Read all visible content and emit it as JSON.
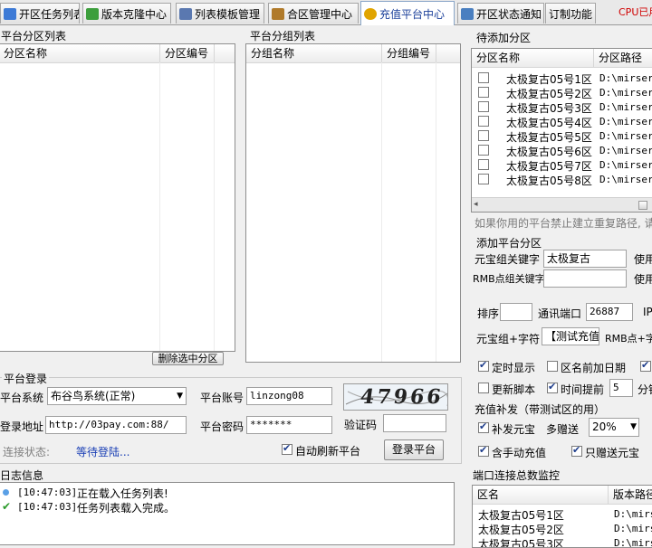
{
  "tabs": [
    {
      "label": "开区任务列表",
      "icon": "calendar-icon",
      "color": "#3d7ad6"
    },
    {
      "label": "版本克隆中心",
      "icon": "clone-icon",
      "color": "#3c9e3c"
    },
    {
      "label": "列表模板管理",
      "icon": "template-icon",
      "color": "#5a78b0"
    },
    {
      "label": "合区管理中心",
      "icon": "merge-icon",
      "color": "#b07a2a"
    },
    {
      "label": "充值平台中心",
      "icon": "coin-icon",
      "color": "#e0a400"
    },
    {
      "label": "开区状态通知",
      "icon": "notify-icon",
      "color": "#4a7fc0"
    },
    {
      "label": "订制功能",
      "icon": "custom-icon",
      "color": "#888888"
    }
  ],
  "cpu_text": "CPU已用",
  "platform_partition_list": {
    "title": "平台分区列表",
    "columns": [
      "分区名称",
      "分区编号"
    ],
    "delete_button": "删除选中分区"
  },
  "platform_group_list": {
    "title": "平台分组列表",
    "columns": [
      "分组名称",
      "分组编号"
    ]
  },
  "pending_partitions": {
    "title": "待添加分区",
    "columns": [
      "分区名称",
      "分区路径"
    ],
    "rows": [
      {
        "name": "太极复古05号1区",
        "path": "D:\\mirserv",
        "checked": false
      },
      {
        "name": "太极复古05号2区",
        "path": "D:\\mirserv",
        "checked": false
      },
      {
        "name": "太极复古05号3区",
        "path": "D:\\mirserv",
        "checked": false
      },
      {
        "name": "太极复古05号4区",
        "path": "D:\\mirserv",
        "checked": false
      },
      {
        "name": "太极复古05号5区",
        "path": "D:\\mirserv",
        "checked": false
      },
      {
        "name": "太极复古05号6区",
        "path": "D:\\mirserv",
        "checked": false
      },
      {
        "name": "太极复古05号7区",
        "path": "D:\\mirserv",
        "checked": false
      },
      {
        "name": "太极复古05号8区",
        "path": "D:\\mirserv",
        "checked": false
      }
    ],
    "hint": "如果你用的平台禁止建立重复路径, 请"
  },
  "add_partition": {
    "title": "添加平台分区",
    "yuanbao_keyword_label": "元宝组关键字",
    "yuanbao_keyword_value": "太极复古",
    "use_label_1": "使用",
    "rmb_keyword_label": "RMB点组关键字",
    "rmb_keyword_value": "",
    "use_label_2": "使用",
    "sort_label": "排序",
    "sort_value": "",
    "port_label": "通讯端口",
    "port_value": "26887",
    "ip_label": "IP",
    "yuanbao_group_label": "元宝组+字符",
    "yuanbao_group_value": "【测试充值",
    "rmb_group_label": "RMB点+字符",
    "opt_timed_show": "定时显示",
    "opt_date_prefix": "区名前加日期",
    "opt_update_script": "更新脚本",
    "opt_time_advance": "时间提前",
    "time_advance_value": "5",
    "minute_label": "分钟"
  },
  "topup_bonus": {
    "title": "充值补发（带测试区的用）",
    "opt_bonus_yuanbao": "补发元宝",
    "more_gift_label": "多赠送",
    "more_gift_value": "20%",
    "opt_manual_topup": "含手动充值",
    "opt_gift_only_yuanbao": "只赠送元宝"
  },
  "platform_login": {
    "title": "平台登录",
    "system_label": "平台系统",
    "system_value": "布谷鸟系统(正常)",
    "account_label": "平台账号",
    "account_value": "linzong08",
    "captcha_text": "47966",
    "url_label": "登录地址",
    "url_value": "http://03pay.com:88/",
    "password_label": "平台密码",
    "password_value": "*******",
    "code_label": "验证码",
    "code_value": "",
    "status_label": "连接状态:",
    "status_value": "等待登陆...",
    "auto_refresh_label": "自动刷新平台",
    "login_button": "登录平台"
  },
  "log": {
    "title": "日志信息",
    "lines": [
      {
        "time": "[10:47:03]",
        "text": "正在载入任务列表!",
        "icon": "info-dot-icon"
      },
      {
        "time": "[10:47:03]",
        "text": "任务列表载入完成。",
        "icon": "check-icon"
      }
    ]
  },
  "port_monitor": {
    "title": "端口连接总数监控",
    "columns": [
      "区名",
      "版本路径"
    ],
    "rows": [
      {
        "name": "太极复古05号1区",
        "path": "D:\\mirs"
      },
      {
        "name": "太极复古05号2区",
        "path": "D:\\mirs"
      },
      {
        "name": "太极复古05号3区",
        "path": "D:\\mirs"
      }
    ]
  },
  "colors": {
    "status_blue": "#1a3fb5",
    "cpu_red": "#d00000",
    "captcha_bg": "#eef3f8"
  }
}
